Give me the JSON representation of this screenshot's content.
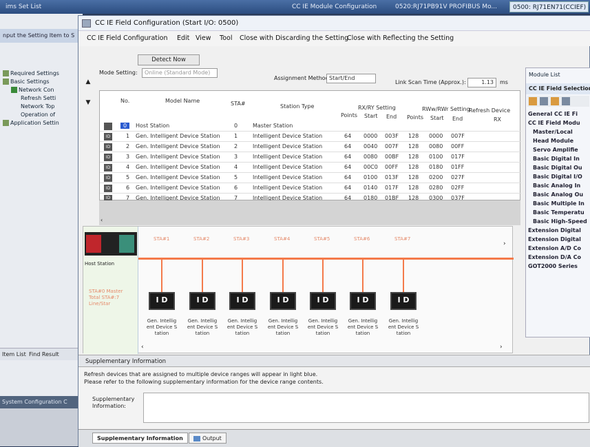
{
  "taskbar": {
    "items": [
      "ims Set List",
      "CC IE Module Configuration",
      "0520:RJ71PB91V PROFIBUS Mo...",
      "0500: RJ71EN71(CCIEF)"
    ]
  },
  "left_panel": {
    "header": "nput the Setting Item to S",
    "tree": [
      "Required Settings",
      "Basic Settings",
      "Network Con",
      "Refresh Setti",
      "Network Top",
      "Operation of",
      "Application Settin"
    ],
    "tabs": [
      "Item List",
      "Find Result"
    ],
    "system_config": "System Configuration C"
  },
  "dialog": {
    "title": "CC IE Field Configuration (Start I/O: 0500)",
    "menu": [
      "CC IE Field Configuration",
      "Edit",
      "View",
      "Tool",
      "Close with Discarding the Setting",
      "Close with Reflecting the Setting"
    ],
    "detect_now": "Detect Now",
    "mode_setting_label": "Mode Setting:",
    "mode_setting_value": "Online (Standard Mode)",
    "assignment_method_label": "Assignment Method:",
    "assignment_method_value": "Start/End",
    "link_scan_label": "Link Scan Time (Approx.):",
    "link_scan_value": "1.13",
    "link_scan_unit": "ms"
  },
  "table": {
    "headers": {
      "no": "No.",
      "model": "Model Name",
      "sta": "STA#",
      "type": "Station Type",
      "rxry": "RX/RY Setting",
      "rwwrwr": "RWw/RWr Setting",
      "refresh": "Refresh Device",
      "points": "Points",
      "start": "Start",
      "end": "End",
      "rx": "RX"
    },
    "rows": [
      {
        "no": "0",
        "model": "Host Station",
        "sta": "0",
        "type": "Master Station",
        "p1": "",
        "s1": "",
        "e1": "",
        "p2": "",
        "s2": "",
        "e2": ""
      },
      {
        "no": "1",
        "model": "Gen. Intelligent Device Station",
        "sta": "1",
        "type": "Intelligent Device Station",
        "p1": "64",
        "s1": "0000",
        "e1": "003F",
        "p2": "128",
        "s2": "0000",
        "e2": "007F"
      },
      {
        "no": "2",
        "model": "Gen. Intelligent Device Station",
        "sta": "2",
        "type": "Intelligent Device Station",
        "p1": "64",
        "s1": "0040",
        "e1": "007F",
        "p2": "128",
        "s2": "0080",
        "e2": "00FF"
      },
      {
        "no": "3",
        "model": "Gen. Intelligent Device Station",
        "sta": "3",
        "type": "Intelligent Device Station",
        "p1": "64",
        "s1": "0080",
        "e1": "00BF",
        "p2": "128",
        "s2": "0100",
        "e2": "017F"
      },
      {
        "no": "4",
        "model": "Gen. Intelligent Device Station",
        "sta": "4",
        "type": "Intelligent Device Station",
        "p1": "64",
        "s1": "00C0",
        "e1": "00FF",
        "p2": "128",
        "s2": "0180",
        "e2": "01FF"
      },
      {
        "no": "5",
        "model": "Gen. Intelligent Device Station",
        "sta": "5",
        "type": "Intelligent Device Station",
        "p1": "64",
        "s1": "0100",
        "e1": "013F",
        "p2": "128",
        "s2": "0200",
        "e2": "027F"
      },
      {
        "no": "6",
        "model": "Gen. Intelligent Device Station",
        "sta": "6",
        "type": "Intelligent Device Station",
        "p1": "64",
        "s1": "0140",
        "e1": "017F",
        "p2": "128",
        "s2": "0280",
        "e2": "02FF"
      },
      {
        "no": "7",
        "model": "Gen. Intelligent Device Station",
        "sta": "7",
        "type": "Intelligent Device Station",
        "p1": "64",
        "s1": "0180",
        "e1": "01BF",
        "p2": "128",
        "s2": "0300",
        "e2": "037F"
      }
    ]
  },
  "diagram": {
    "host_label": "Host Station",
    "host_info": "STA#0 Master Total STA#:7 Line/Star",
    "sta_labels": [
      "STA#1",
      "STA#2",
      "STA#3",
      "STA#4",
      "STA#5",
      "STA#6",
      "STA#7"
    ],
    "io_text": "I D",
    "station_caption": "Gen. Intellig ent Device S tation"
  },
  "module_list": {
    "title": "Module List",
    "subtitle": "CC IE Field Selection",
    "items": [
      "General CC IE Fi",
      "CC IE Field Modu",
      "Master/Local",
      "Head Module",
      "Servo Amplifie",
      "Basic Digital In",
      "Basic Digital Ou",
      "Basic Digital I/O",
      "Basic Analog In",
      "Basic Analog Ou",
      "Basic Multiple In",
      "Basic Temperatu",
      "Basic High-Speed",
      "Extension Digital",
      "Extension Digital",
      "Extension A/D Co",
      "Extension D/A Co",
      "GOT2000 Series"
    ]
  },
  "supplementary": {
    "header": "Supplementary Information",
    "line1": "Refresh devices that are assigned to multiple device ranges will appear in light blue.",
    "line2": "Please refer to the following supplementary information for the device range contents.",
    "label": "Supplementary Information:",
    "tab_supp": "Supplementary Information",
    "tab_output": "Output"
  }
}
